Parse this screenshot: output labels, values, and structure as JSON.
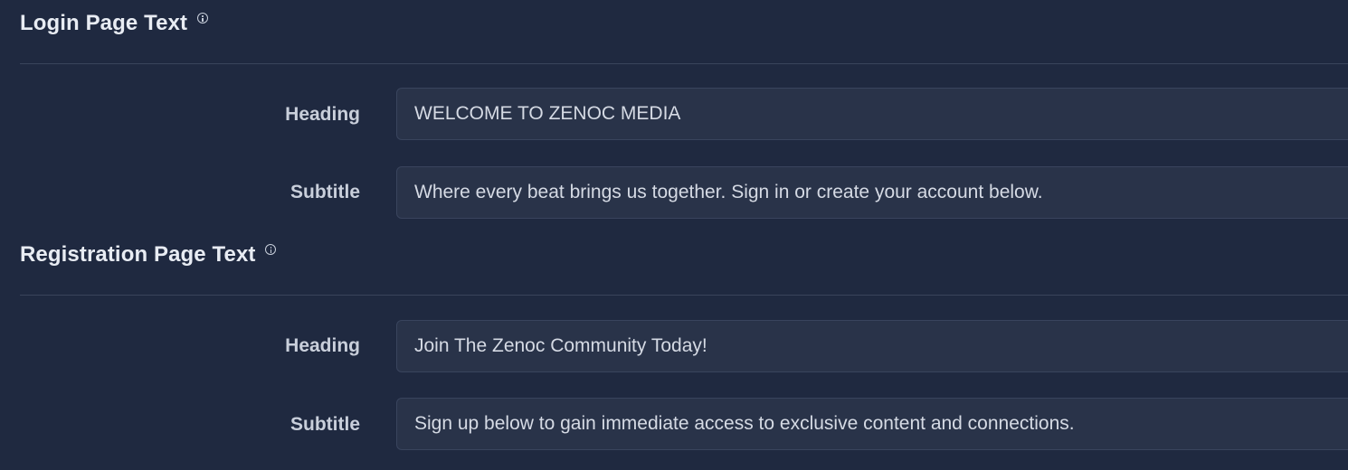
{
  "login": {
    "title": "Login Page Text",
    "heading_label": "Heading",
    "heading_value": "WELCOME TO ZENOC MEDIA",
    "subtitle_label": "Subtitle",
    "subtitle_value": "Where every beat brings us together. Sign in or create your account below."
  },
  "registration": {
    "title": "Registration Page Text",
    "heading_label": "Heading",
    "heading_value": "Join The Zenoc Community Today!",
    "subtitle_label": "Subtitle",
    "subtitle_value": "Sign up below to gain immediate access to exclusive content and connections."
  },
  "icons": {
    "section_info": "info-icon"
  },
  "colors": {
    "background": "#1f2940",
    "input_background": "#293349",
    "input_border": "#39445d",
    "divider": "#39445b",
    "text": "#d7dce6"
  }
}
